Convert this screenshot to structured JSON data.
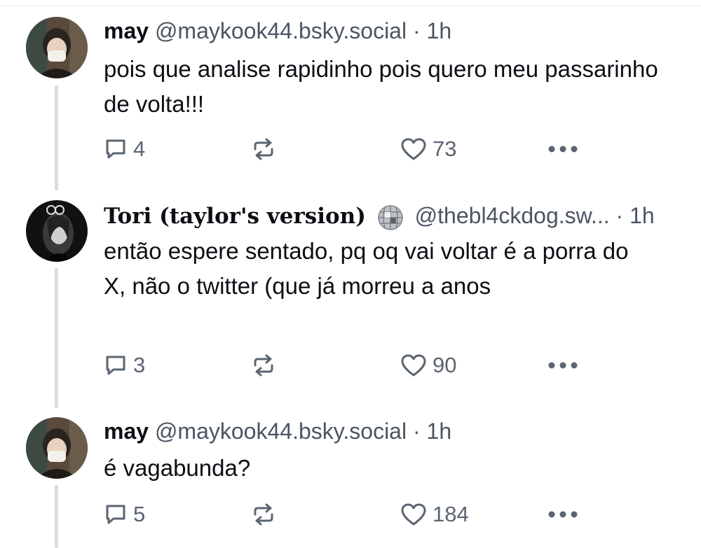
{
  "posts": [
    {
      "display_name": "may",
      "handle": "@maykook44.bsky.social",
      "separator": "·",
      "time": "1h",
      "text": "pois que analise rapidinho pois quero meu passarinho de volta!!!",
      "replies": "4",
      "likes": "73"
    },
    {
      "display_name": "Tori (taylor's version)",
      "handle": "@thebl4ckdog.sw...",
      "separator": "·",
      "time": "1h",
      "text": "então espere sentado, pq oq vai voltar é a porra do X, não o twitter (que já morreu a anos",
      "replies": "3",
      "likes": "90"
    },
    {
      "display_name": "may",
      "handle": "@maykook44.bsky.social",
      "separator": "·",
      "time": "1h",
      "text": "é vagabunda?",
      "replies": "5",
      "likes": "184"
    }
  ],
  "icons": {
    "reply": "speech-bubble-icon",
    "repost": "repost-arrows-icon",
    "like": "heart-icon",
    "more": "ellipsis-icon",
    "badge": "disco-ball-icon"
  }
}
